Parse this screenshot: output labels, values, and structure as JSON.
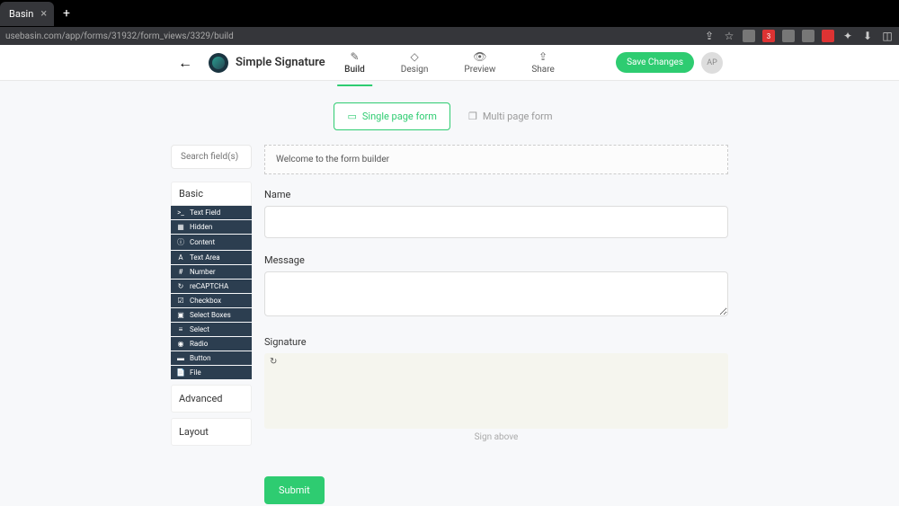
{
  "browser": {
    "tab_title": "Basin",
    "url": "usebasin.com/app/forms/31932/form_views/3329/build"
  },
  "header": {
    "title": "Simple Signature",
    "tabs": [
      {
        "icon": "✎",
        "label": "Build",
        "active": true
      },
      {
        "icon": "◇",
        "label": "Design"
      },
      {
        "icon": "👁",
        "label": "Preview"
      },
      {
        "icon": "⇪",
        "label": "Share"
      }
    ],
    "save_label": "Save Changes",
    "avatar_initials": "AP"
  },
  "page_type": {
    "single": "Single page form",
    "multi": "Multi page form"
  },
  "sidebar": {
    "search_placeholder": "Search field(s)",
    "basic_label": "Basic",
    "fields": [
      {
        "icon": ">_",
        "label": "Text Field"
      },
      {
        "icon": "▦",
        "label": "Hidden"
      },
      {
        "icon": "ⓘ",
        "label": "Content"
      },
      {
        "icon": "A",
        "label": "Text Area"
      },
      {
        "icon": "#",
        "label": "Number"
      },
      {
        "icon": "↻",
        "label": "reCAPTCHA"
      },
      {
        "icon": "☑",
        "label": "Checkbox"
      },
      {
        "icon": "▣",
        "label": "Select Boxes"
      },
      {
        "icon": "≡",
        "label": "Select"
      },
      {
        "icon": "◉",
        "label": "Radio"
      },
      {
        "icon": "▬",
        "label": "Button"
      },
      {
        "icon": "📄",
        "label": "File"
      }
    ],
    "advanced_label": "Advanced",
    "layout_label": "Layout"
  },
  "canvas": {
    "welcome": "Welcome to the form builder",
    "name_label": "Name",
    "message_label": "Message",
    "signature_label": "Signature",
    "signature_hint": "Sign above",
    "submit_label": "Submit"
  }
}
